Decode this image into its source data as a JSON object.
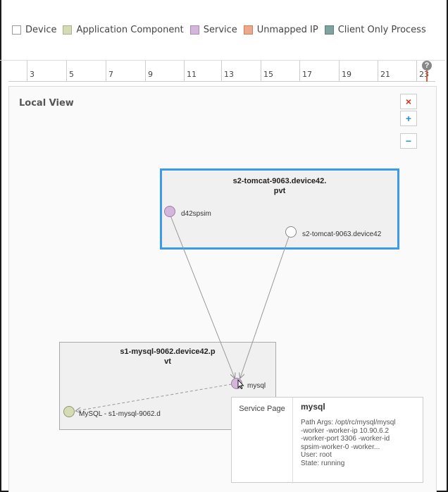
{
  "legend": [
    {
      "label": "Device",
      "color": "#ffffff",
      "icon": "device-swatch"
    },
    {
      "label": "Application Component",
      "color": "#d4dbb5",
      "icon": "app-component-swatch"
    },
    {
      "label": "Service",
      "color": "#d4b6dd",
      "icon": "service-swatch"
    },
    {
      "label": "Unmapped IP",
      "color": "#eda98a",
      "icon": "unmapped-ip-swatch"
    },
    {
      "label": "Client Only Process",
      "color": "#7fa4a0",
      "icon": "client-process-swatch"
    }
  ],
  "timeline": {
    "ticks": [
      "3",
      "5",
      "7",
      "9",
      "11",
      "13",
      "15",
      "17",
      "19",
      "21",
      "23"
    ],
    "help": "?"
  },
  "panel": {
    "title": "Local View",
    "zoom": {
      "close": "×",
      "in": "+",
      "out": "−"
    }
  },
  "groups": {
    "tomcat": {
      "title_line1": "s2-tomcat-9063.device42.",
      "title_line2": "pvt"
    },
    "mysql": {
      "title_line1": "s1-mysql-9062.device42.p",
      "title_line2": "vt"
    }
  },
  "nodes": {
    "d42spsim": {
      "label": "d42spsim",
      "color": "#d4b6dd"
    },
    "s2tomcat": {
      "label": "s2-tomcat-9063.device42",
      "color": "#ffffff"
    },
    "mysql_service": {
      "label": "mysql",
      "color": "#d4b6dd"
    },
    "mysql_app": {
      "label": "MySQL - s1-mysql-9062.d",
      "color": "#d4dbb5"
    }
  },
  "tooltip": {
    "link": "Service Page",
    "title": "mysql",
    "lines": [
      "Path Args: /opt/rc/mysql/mysql",
      "-worker -worker-ip 10.90.6.2",
      "-worker-port 3306 -worker-id",
      "spsim-worker-0 -worker...",
      "User: root",
      "State: running"
    ]
  }
}
